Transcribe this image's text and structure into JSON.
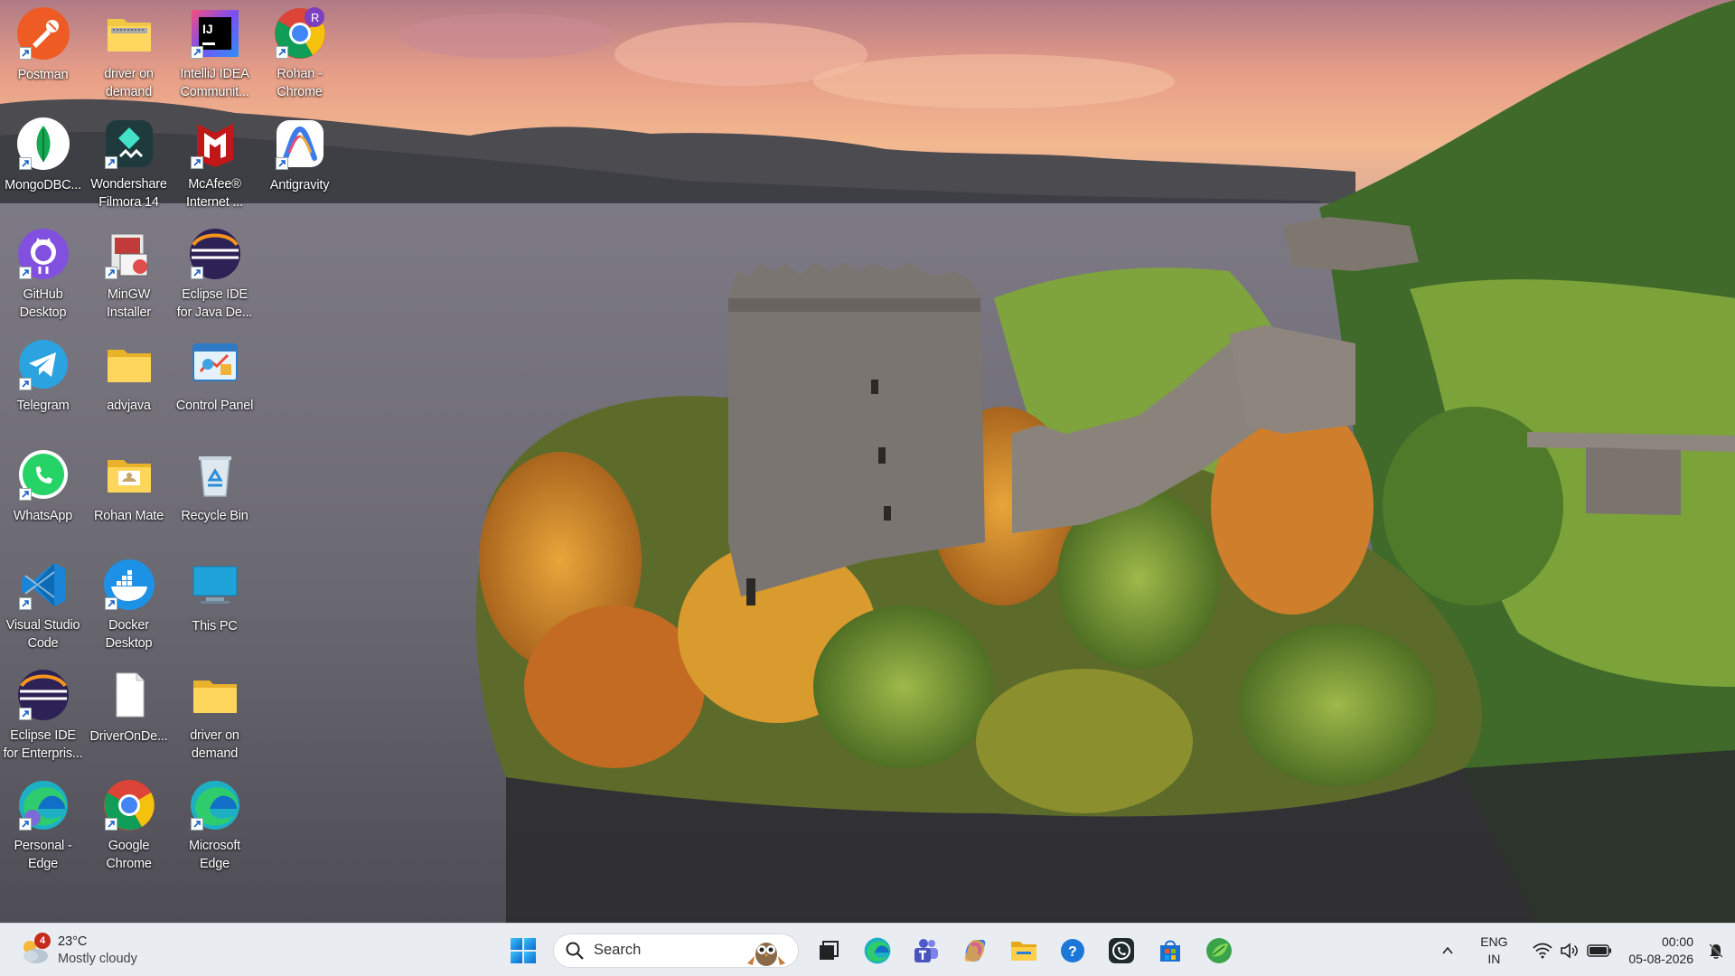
{
  "desktop": {
    "icons": [
      {
        "label": "Postman",
        "icon": "postman-icon",
        "shortcut": true
      },
      {
        "label": "driver on\ndemand",
        "icon": "zip-folder-icon",
        "shortcut": false
      },
      {
        "label": "IntelliJ IDEA\nCommunit...",
        "icon": "intellij-icon",
        "shortcut": true
      },
      {
        "label": "Rohan -\nChrome",
        "icon": "chrome-profile-icon",
        "shortcut": true,
        "profile_letter": "R"
      },
      {
        "label": "MongoDBC...",
        "icon": "mongodb-compass-icon",
        "shortcut": true
      },
      {
        "label": "Wondershare\nFilmora 14",
        "icon": "filmora-icon",
        "shortcut": true
      },
      {
        "label": "McAfee®\nInternet ...",
        "icon": "mcafee-icon",
        "shortcut": true
      },
      {
        "label": "Antigravity",
        "icon": "antigravity-icon",
        "shortcut": true
      },
      {
        "label": "GitHub\nDesktop",
        "icon": "github-desktop-icon",
        "shortcut": true
      },
      {
        "label": "MinGW\nInstaller",
        "icon": "mingw-installer-icon",
        "shortcut": true
      },
      {
        "label": "Eclipse IDE\nfor Java De...",
        "icon": "eclipse-icon",
        "shortcut": true
      },
      {
        "label": "Telegram",
        "icon": "telegram-icon",
        "shortcut": true
      },
      {
        "label": "advjava",
        "icon": "folder-icon",
        "shortcut": false
      },
      {
        "label": "Control Panel",
        "icon": "control-panel-icon",
        "shortcut": false
      },
      {
        "label": "WhatsApp",
        "icon": "whatsapp-icon",
        "shortcut": true
      },
      {
        "label": "Rohan Mate",
        "icon": "user-folder-icon",
        "shortcut": false
      },
      {
        "label": "Recycle Bin",
        "icon": "recycle-bin-icon",
        "shortcut": false
      },
      {
        "label": "Visual Studio\nCode",
        "icon": "vscode-icon",
        "shortcut": true
      },
      {
        "label": "Docker\nDesktop",
        "icon": "docker-icon",
        "shortcut": true
      },
      {
        "label": "This PC",
        "icon": "this-pc-icon",
        "shortcut": false
      },
      {
        "label": "Eclipse IDE\nfor Enterpris...",
        "icon": "eclipse-icon",
        "shortcut": true
      },
      {
        "label": "DriverOnDe...",
        "icon": "blank-file-icon",
        "shortcut": false
      },
      {
        "label": "driver on\ndemand",
        "icon": "folder-icon",
        "shortcut": false
      },
      {
        "label": "Personal -\nEdge",
        "icon": "edge-profile-icon",
        "shortcut": true
      },
      {
        "label": "Google\nChrome",
        "icon": "chrome-icon",
        "shortcut": true
      },
      {
        "label": "Microsoft\nEdge",
        "icon": "edge-icon",
        "shortcut": true
      }
    ]
  },
  "taskbar": {
    "weather": {
      "badge": "4",
      "temperature": "23°C",
      "condition": "Mostly cloudy",
      "icon": "cloudy-weather-icon"
    },
    "start_icon": "windows-start-icon",
    "search": {
      "placeholder": "Search",
      "icon": "search-icon"
    },
    "apps": [
      {
        "name": "task-view",
        "icon": "task-view-icon"
      },
      {
        "name": "edge",
        "icon": "edge-icon"
      },
      {
        "name": "teams",
        "icon": "teams-icon"
      },
      {
        "name": "copilot",
        "icon": "copilot-icon"
      },
      {
        "name": "file-explorer",
        "icon": "file-explorer-icon"
      },
      {
        "name": "get-help",
        "icon": "help-icon"
      },
      {
        "name": "whatsapp",
        "icon": "whatsapp-icon"
      },
      {
        "name": "microsoft-store",
        "icon": "store-icon"
      },
      {
        "name": "app-green",
        "icon": "green-leaf-app-icon"
      }
    ],
    "tray": {
      "chevron_icon": "chevron-up-icon",
      "language_line1": "ENG",
      "language_line2": "IN",
      "wifi_icon": "wifi-icon",
      "volume_icon": "volume-icon",
      "battery_icon": "battery-icon",
      "time": "00:00",
      "date": "05-08-2026",
      "notification_icon": "notification-bell-icon"
    }
  }
}
